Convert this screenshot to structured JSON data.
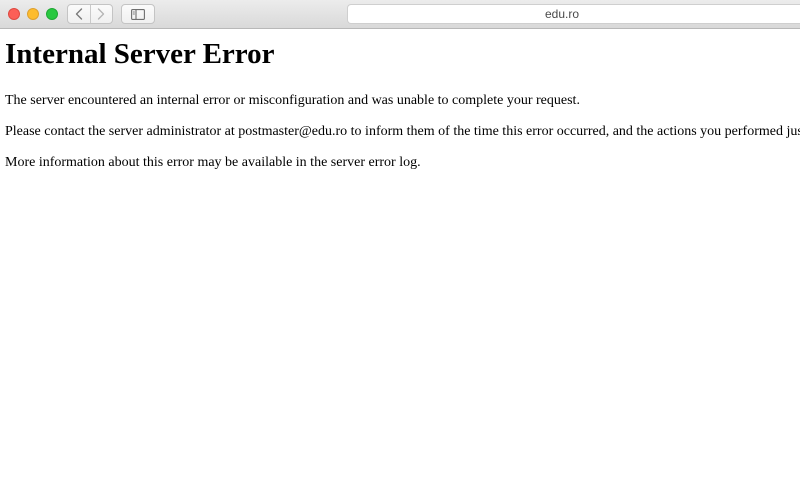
{
  "browser": {
    "address": "edu.ro",
    "colors": {
      "close": "#fc5f57",
      "minimize": "#fdbc2e",
      "zoom": "#28c840"
    },
    "icons": {
      "back": "chevron-left-icon",
      "forward": "chevron-right-icon",
      "sidebar": "sidebar-icon"
    }
  },
  "page": {
    "title": "Internal Server Error",
    "paragraphs": [
      "The server encountered an internal error or misconfiguration and was unable to complete your request.",
      "Please contact the server administrator at postmaster@edu.ro to inform them of the time this error occurred, and the actions you performed just before this error.",
      "More information about this error may be available in the server error log."
    ]
  }
}
